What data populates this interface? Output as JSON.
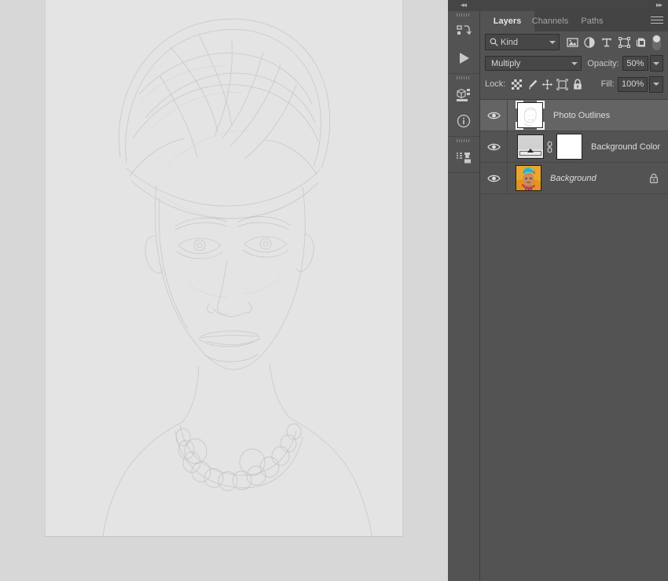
{
  "dock": {
    "collapse_arrows": "◂◂",
    "expand_arrows": "▸▸"
  },
  "icon_rail": {
    "items": [
      {
        "name": "history-actions-icon",
        "tooltip": "History"
      },
      {
        "name": "play-actions-icon",
        "tooltip": "Actions"
      },
      {
        "name": "properties-3d-icon",
        "tooltip": "Properties"
      },
      {
        "name": "info-icon",
        "tooltip": "Info"
      },
      {
        "name": "clone-source-icon",
        "tooltip": "Clone Source"
      }
    ]
  },
  "panel": {
    "tabs": [
      {
        "label": "Layers",
        "active": true
      },
      {
        "label": "Channels",
        "active": false
      },
      {
        "label": "Paths",
        "active": false
      }
    ],
    "menu_icon": "panel-menu-icon",
    "filter": {
      "search_icon": "search-icon",
      "kind_value": "Kind",
      "icons": [
        {
          "name": "filter-pixel-icon"
        },
        {
          "name": "filter-adjustment-icon"
        },
        {
          "name": "filter-type-icon"
        },
        {
          "name": "filter-shape-icon"
        },
        {
          "name": "filter-smart-object-icon"
        }
      ],
      "toggle_on": false
    },
    "blend": {
      "mode": "Multiply",
      "opacity_label": "Opacity:",
      "opacity_value": "50%"
    },
    "lock": {
      "label": "Lock:",
      "icons": [
        {
          "name": "lock-transparent-pixels-icon"
        },
        {
          "name": "lock-image-pixels-icon"
        },
        {
          "name": "lock-position-icon"
        },
        {
          "name": "lock-artboard-nesting-icon"
        },
        {
          "name": "lock-all-icon"
        }
      ],
      "fill_label": "Fill:",
      "fill_value": "100%"
    },
    "layers": [
      {
        "name": "Photo Outlines",
        "visible": true,
        "selected": true,
        "italic": false,
        "locked": false,
        "thumb_type": "sketch",
        "has_mask": false,
        "has_link": false
      },
      {
        "name": "Background Color",
        "visible": true,
        "selected": false,
        "italic": false,
        "locked": false,
        "thumb_type": "gradient-fill",
        "has_mask": true,
        "has_link": true
      },
      {
        "name": "Background",
        "visible": true,
        "selected": false,
        "italic": true,
        "locked": true,
        "thumb_type": "portrait",
        "has_mask": false,
        "has_link": false
      }
    ]
  },
  "canvas": {
    "document_name": "portrait-sketch-document",
    "artwork_description": "Faint pencil outline sketch of a woman wearing a head wrap and beaded necklace"
  },
  "colors": {
    "panel_bg": "#535353",
    "panel_dark": "#444444",
    "field_bg": "#474747",
    "row_selected": "#646464",
    "text": "#dedede",
    "canvas_bg": "#d7d7d7",
    "document_bg": "#e4e4e4"
  }
}
